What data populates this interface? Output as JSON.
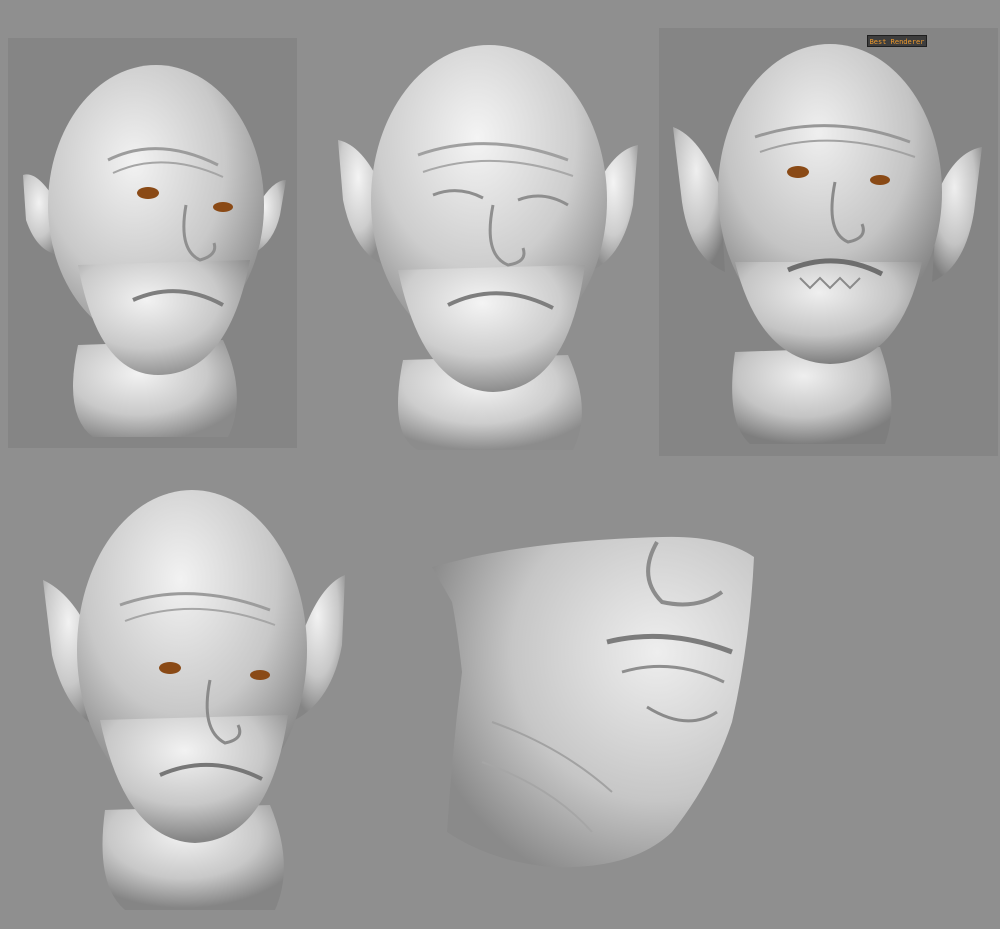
{
  "renderer_badge": {
    "label": "Best Renderer"
  },
  "colors": {
    "canvas": "#8f8f8f",
    "viewport_panel": "#858585",
    "clay": "#d9d9d9",
    "badge_text": "#ef9a2c",
    "badge_bg": "#3d3d3d",
    "eye": "#8a4a16"
  },
  "renders": [
    {
      "id": "head-front-smooth",
      "subject": "head-icon"
    },
    {
      "id": "head-front-detailed",
      "subject": "head-icon"
    },
    {
      "id": "head-front-best-render",
      "subject": "head-icon"
    },
    {
      "id": "head-front-closeup",
      "subject": "head-icon"
    },
    {
      "id": "neck-jaw-crop",
      "subject": "jaw-neck-icon"
    }
  ]
}
